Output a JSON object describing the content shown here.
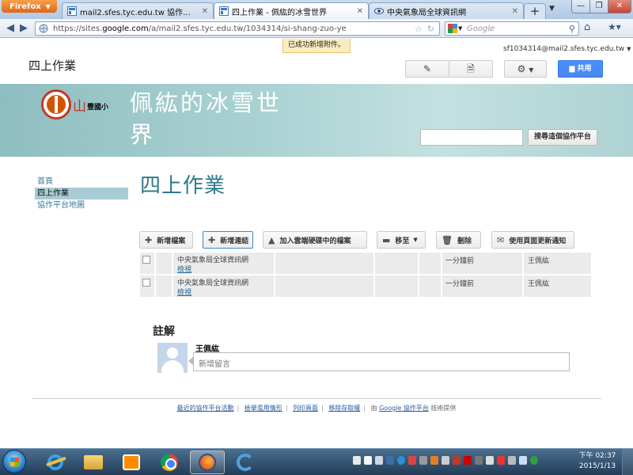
{
  "browser": {
    "menu_label": "Firefox",
    "tabs": [
      {
        "label": "mail2.sfes.tyc.edu.tw 協作平台 - Go..."
      },
      {
        "label": "四上作業 - 佩紘的冰雪世界"
      },
      {
        "label": "中央氣象局全球資訊網"
      }
    ],
    "url_prefix": "https://sites.",
    "url_domain": "google.com",
    "url_rest": "/a/mail2.sfes.tyc.edu.tw/1034314/si-shang-zuo-ye",
    "search_placeholder": "Google"
  },
  "notification": "已成功新增附件。",
  "header": {
    "user_email": "sf1034314@mail2.sfes.tyc.edu.tw",
    "page_heading": "四上作業",
    "share_label": "共用"
  },
  "banner": {
    "logo_char": "山",
    "logo_school": "豐國小",
    "site_title": "佩紘的冰雪世界",
    "search_button": "搜尋這個協作平台"
  },
  "sidebar": {
    "items": [
      {
        "label": "首頁"
      },
      {
        "label": "四上作業"
      },
      {
        "label": "協作平台地圖"
      }
    ]
  },
  "main": {
    "title": "四上作業",
    "toolbar": {
      "new_file": "新增檔案",
      "new_link": "新增連結",
      "add_drive": "加入雲端硬碟中的檔案",
      "move_to": "移至",
      "delete": "刪除",
      "notify": "使用頁面更新通知"
    },
    "files": [
      {
        "name": "中央氣象局全球資訊網",
        "view": "檢視",
        "time": "一分鐘前",
        "user": "王佩紘"
      },
      {
        "name": "中央氣象局全球資訊網",
        "view": "檢視",
        "time": "一分鐘前",
        "user": "王佩紘"
      }
    ]
  },
  "comments": {
    "title": "註解",
    "user": "王佩紘",
    "placeholder": "新增留言"
  },
  "footer": {
    "links": [
      "最近的協作平台活動",
      "檢舉濫用情形",
      "列印頁面",
      "移除存取權"
    ],
    "powered_prefix": "由",
    "powered_link": "Google 協作平台",
    "powered_suffix": "技術提供"
  },
  "taskbar": {
    "time": "下午 02:37",
    "date": "2015/1/13"
  }
}
